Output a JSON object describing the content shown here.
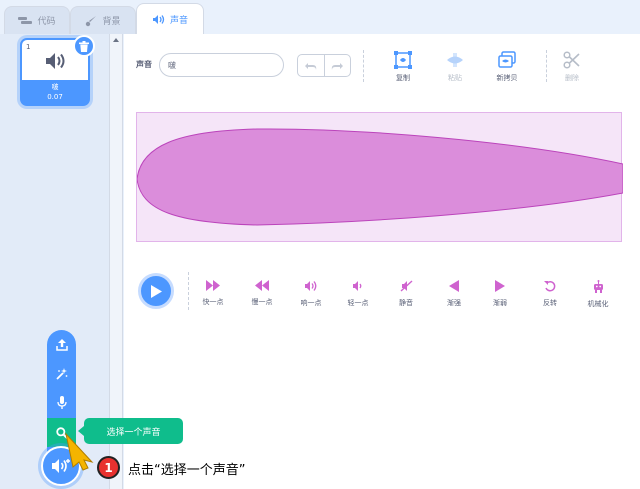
{
  "tabs": [
    {
      "label": "代码",
      "icon": "code-icon"
    },
    {
      "label": "背景",
      "icon": "brush-icon"
    },
    {
      "label": "声音",
      "icon": "speaker-icon"
    }
  ],
  "sound_list": {
    "items": [
      {
        "index": "1",
        "name": "啵",
        "duration": "0.07"
      }
    ]
  },
  "editor": {
    "sound_label": "声音",
    "sound_name_value": "啵",
    "tools": {
      "copy": "复制",
      "paste": "粘贴",
      "copy_new": "新拷贝",
      "delete": "删除"
    },
    "effects": [
      {
        "label": "快一点",
        "icon": "faster-icon"
      },
      {
        "label": "慢一点",
        "icon": "slower-icon"
      },
      {
        "label": "响一点",
        "icon": "louder-icon"
      },
      {
        "label": "轻一点",
        "icon": "softer-icon"
      },
      {
        "label": "静音",
        "icon": "mute-icon"
      },
      {
        "label": "渐强",
        "icon": "fade-in-icon"
      },
      {
        "label": "渐弱",
        "icon": "fade-out-icon"
      },
      {
        "label": "反转",
        "icon": "reverse-icon"
      },
      {
        "label": "机械化",
        "icon": "robot-icon"
      }
    ]
  },
  "add_menu": {
    "tooltip": "选择一个声音"
  },
  "annotation": {
    "step_number": "1",
    "step_text": "点击“选择一个声音”"
  },
  "colors": {
    "accent": "#4c97ff",
    "green": "#0fbd8c",
    "wave_fill": "#cf63cf",
    "wave_bg": "#f5e5f8",
    "badge": "#e8312f"
  }
}
